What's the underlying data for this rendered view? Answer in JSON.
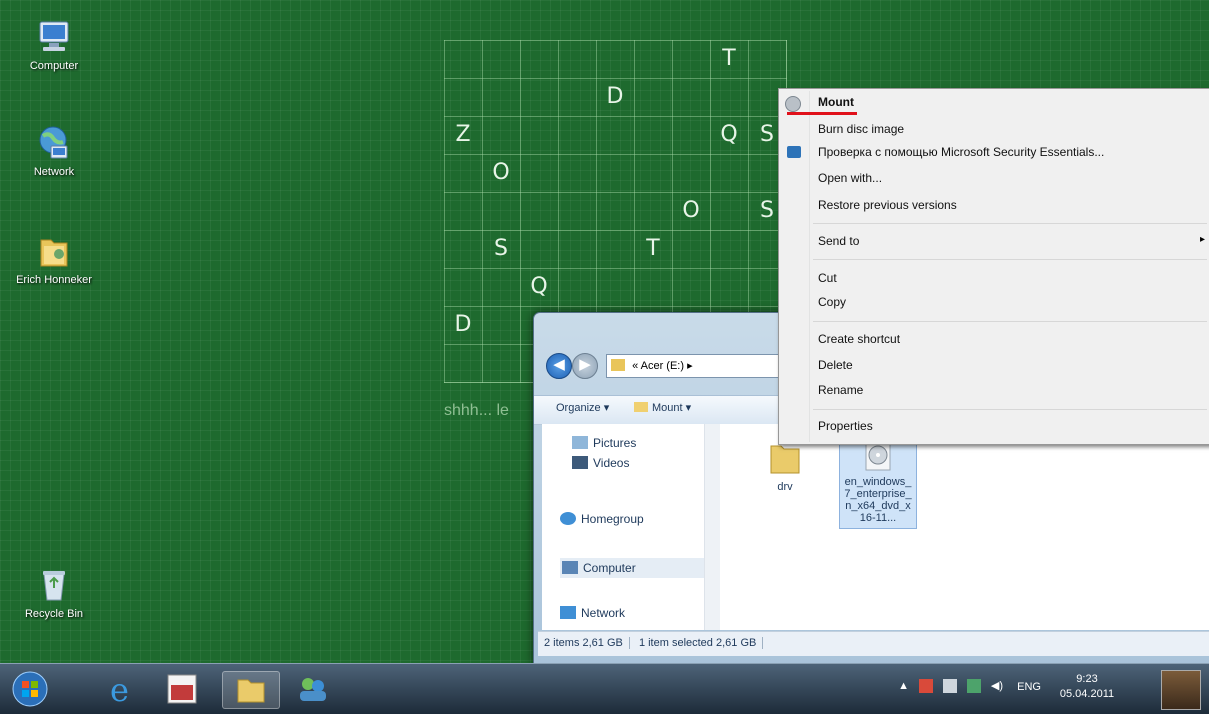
{
  "desktop": {
    "icons": [
      {
        "label": "Computer"
      },
      {
        "label": "Network"
      },
      {
        "label": "Erich Honneker"
      },
      {
        "label": "Recycle Bin"
      }
    ]
  },
  "puzzle": {
    "letters": [
      "T",
      "D",
      "Z",
      "Q",
      "S",
      "O",
      "O",
      "S",
      "S",
      "T",
      "Q",
      "D"
    ],
    "caption": "shhh... le"
  },
  "explorer": {
    "address": "« Acer (E:) ▸",
    "toolbar": {
      "organize": "Organize ▾",
      "mount": "Mount ▾"
    },
    "nav_items": [
      "Pictures",
      "Videos",
      "Homegroup",
      "Computer",
      "Network"
    ],
    "files": [
      {
        "name": "drv"
      },
      {
        "name": "en_windows_7_enterprise_n_x64_dvd_x16-11..."
      }
    ],
    "status": {
      "items": "2 items  2,61 GB",
      "selected": "1 item selected  2,61 GB"
    }
  },
  "context_menu": {
    "items": [
      "Mount",
      "Burn disc image",
      "Проверка с помощью Microsoft Security Essentials...",
      "Open with...",
      "Restore previous versions",
      "Send to",
      "Cut",
      "Copy",
      "Create shortcut",
      "Delete",
      "Rename",
      "Properties"
    ],
    "submenu_arrow": "▸"
  },
  "taskbar": {
    "tray": {
      "lang": "ENG",
      "time": "9:23",
      "date": "05.04.2011"
    }
  },
  "colors": {
    "desktop": "#1e6a2e",
    "highlight_underline": "#e0101a"
  }
}
